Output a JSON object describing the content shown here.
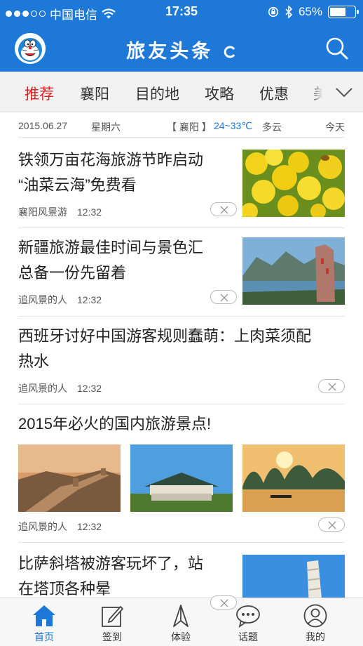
{
  "status_bar": {
    "carrier": "中国电信",
    "time": "17:35",
    "battery": "65%",
    "battery_level": 0.65
  },
  "header": {
    "title": "旅友头条"
  },
  "tabs": [
    "推荐",
    "襄阳",
    "目的地",
    "攻略",
    "优惠",
    "美"
  ],
  "info_bar": {
    "date": "2015.06.27",
    "weekday": "星期六",
    "city": "【 襄阳 】",
    "temp": "24~33℃",
    "weather": "多云",
    "day": "今天"
  },
  "news": [
    {
      "title_line1": "铁领万亩花海旅游节昨启动",
      "title_line2": "“油菜云海”免费看",
      "source": "襄阳风景游",
      "time": "12:32"
    },
    {
      "title_line1": "新疆旅游最佳时间与景色汇",
      "title_line2": "总备一份先留着",
      "source": "追风景的人",
      "time": "12:32"
    },
    {
      "title_line1": "西班牙讨好中国游客规则蠢萌：上肉菜须配",
      "title_line2": "热水",
      "source": "追风景的人",
      "time": "12:32"
    },
    {
      "title_line1": "2015年必火的国内旅游景点!",
      "source": "追风景的人",
      "time": "12:32"
    },
    {
      "title_line1": "比萨斜塔被游客玩坏了，站",
      "title_line2": "在塔顶各种晕"
    }
  ],
  "bottom_nav": [
    "首页",
    "签到",
    "体验",
    "话题",
    "我的"
  ],
  "colors": {
    "brand": "#1e78d8",
    "active_tab": "#e02020"
  }
}
